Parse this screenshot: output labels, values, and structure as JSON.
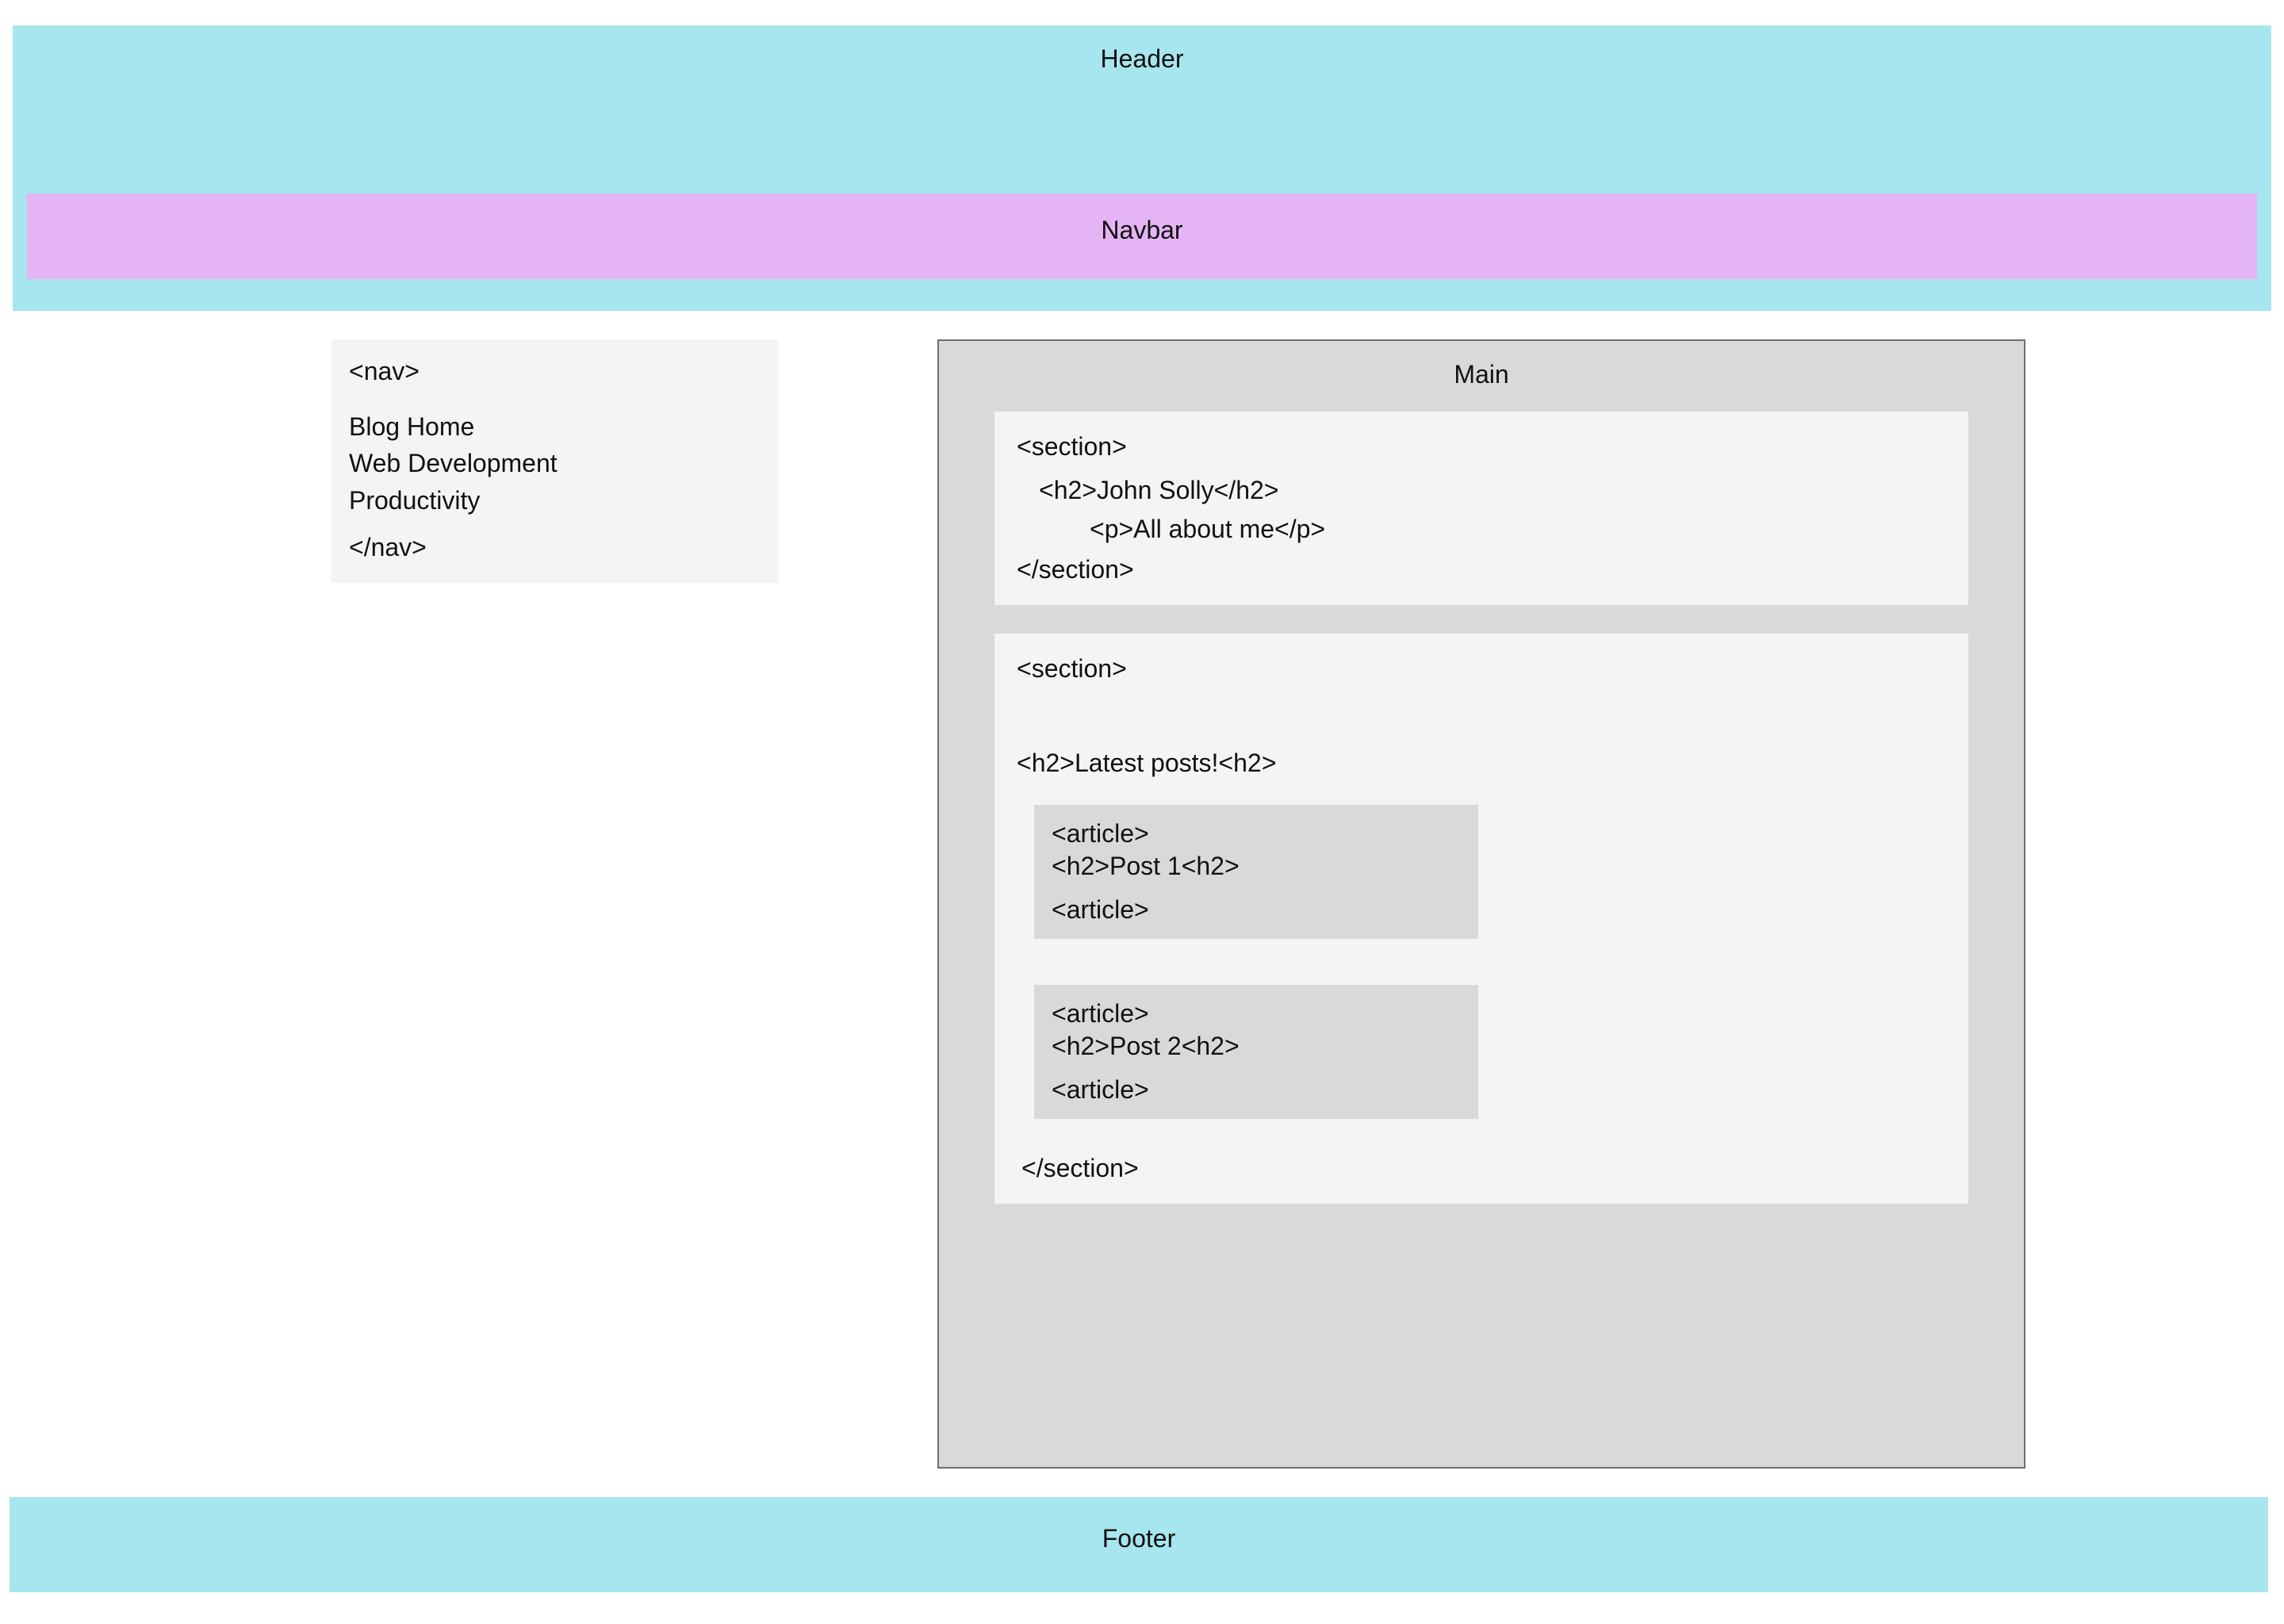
{
  "header": {
    "label": "Header"
  },
  "navbar": {
    "label": "Navbar"
  },
  "nav": {
    "open_tag": "<nav>",
    "close_tag": "</nav>",
    "links": [
      "Blog Home",
      "Web Development",
      "Productivity"
    ]
  },
  "main": {
    "label": "Main",
    "about": {
      "open_tag": "<section>",
      "h2": "<h2>John Solly</h2>",
      "p": "<p>All about me</p>",
      "close_tag": "</section>"
    },
    "latest": {
      "open_tag": "<section>",
      "h2": "<h2>Latest posts!<h2>",
      "close_tag": "</section>",
      "articles": [
        {
          "open_tag": "<article>",
          "h2": "<h2>Post 1<h2>",
          "close_tag": "<article>"
        },
        {
          "open_tag": "<article>",
          "h2": "<h2>Post 2<h2>",
          "close_tag": "<article>"
        }
      ]
    }
  },
  "footer": {
    "label": "Footer"
  },
  "colors": {
    "header_bg": "#a7e6ee",
    "navbar_bg": "#e4b4f4",
    "panel_bg": "#d9d9d9",
    "card_bg": "#f4f4f4",
    "border": "#6f6f6f"
  }
}
